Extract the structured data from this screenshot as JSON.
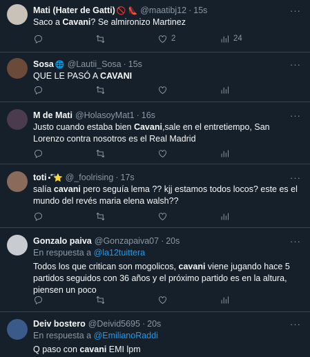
{
  "tweets": [
    {
      "name": "Mati (Hater de Gatti)",
      "emoji": "🚫 👠",
      "handle": "@maatibj12",
      "time": "15s",
      "text_before": "Saco a ",
      "bold": "Cavani",
      "text_after": "? Se almironizo Martinez",
      "replies": "",
      "retweets": "",
      "likes": "2",
      "views": "24",
      "avatar_color": "#c9c2b8"
    },
    {
      "name": "Sosa",
      "emoji": "🌐",
      "handle": "@Lautii_Sosa",
      "time": "15s",
      "text_before": "QUE LE PASÓ A ",
      "bold": "CAVANI",
      "text_after": "",
      "avatar_color": "#6b4a3a"
    },
    {
      "name": "M de Mati",
      "emoji": "",
      "handle": "@HolasoyMat1",
      "time": "16s",
      "text_before": "Justo cuando estaba bien ",
      "bold": "Cavani",
      "text_after": ",sale en el entretiempo, San Lorenzo contra nosotros es el Real Madrid",
      "avatar_color": "#4a3b4f"
    },
    {
      "name": "toti",
      "emoji": "•͡˚⭐",
      "handle": "@_foolrising",
      "time": "17s",
      "text_before": "salía ",
      "bold": "cavani",
      "text_after": " pero seguía lema ?? kjj estamos todos locos? este es el mundo del revés maria elena walsh??",
      "avatar_color": "#8a6a5a"
    },
    {
      "name": "Gonzalo paiva",
      "emoji": "",
      "handle": "@Gonzapaiva07",
      "time": "20s",
      "reply_prefix": "En respuesta a",
      "reply_to": "@la12tuittera",
      "text_before": "Todos los que critican son mogolicos,  ",
      "bold": "cavani",
      "text_after": " viene jugando hace 5 partidos seguidos con 36 años y el próximo partido es en la altura, piensen un poco",
      "avatar_color": "#c8ccd0"
    },
    {
      "name": "Deiv bostero",
      "emoji": "",
      "handle": "@Deivid5695",
      "time": "20s",
      "reply_prefix": "En respuesta a",
      "reply_to": "@EmilianoRaddi",
      "text_before": "Q paso con ",
      "bold": "cavani",
      "text_after": " EMI lpm",
      "avatar_color": "#3a5a8a"
    }
  ],
  "icons": {
    "more": "more-icon",
    "reply": "reply-icon",
    "retweet": "retweet-icon",
    "like": "heart-icon",
    "views": "views-icon"
  },
  "colors": {
    "background": "#15202b",
    "divider": "#38444d",
    "muted": "#8b98a5",
    "link": "#1d9bf0"
  }
}
